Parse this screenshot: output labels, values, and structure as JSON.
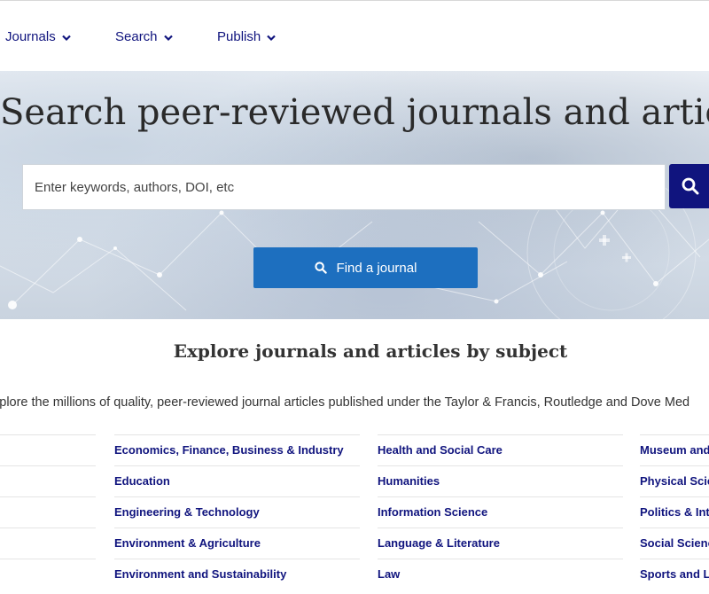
{
  "nav": {
    "items": [
      {
        "label": "Journals"
      },
      {
        "label": "Search"
      },
      {
        "label": "Publish"
      }
    ]
  },
  "hero": {
    "title": "Search peer-reviewed journals and articles",
    "search_placeholder": "Enter keywords, authors, DOI, etc",
    "find_journal_label": "Find a journal"
  },
  "explore": {
    "title": "Explore journals and articles by subject",
    "description": "xplore the millions of quality, peer-reviewed journal articles published under the Taylor & Francis, Routledge and Dove Med"
  },
  "subjects": {
    "col2": [
      "Economics, Finance, Business & Industry",
      "Education",
      "Engineering & Technology",
      "Environment & Agriculture",
      "Environment and Sustainability"
    ],
    "col3": [
      "Health and Social Care",
      "Humanities",
      "Information Science",
      "Language & Literature",
      "Law"
    ],
    "col4": [
      "Museum and",
      "Physical Scien",
      "Politics & Inte",
      "Social Scienc",
      "Sports and Le"
    ]
  },
  "colors": {
    "brand_navy": "#10147e",
    "button_blue": "#1d6fbf",
    "divider": "#e4e4e4"
  },
  "icons": {
    "nav_chevron": "chevron-down-icon",
    "search": "search-icon"
  }
}
